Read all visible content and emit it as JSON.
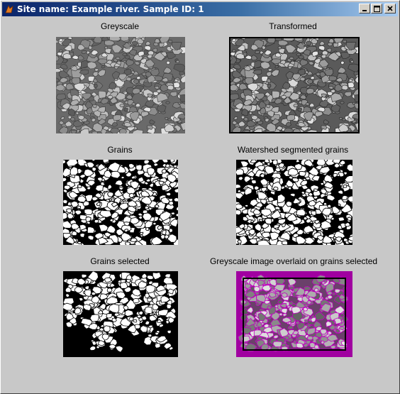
{
  "window": {
    "title": "Site name: Example river. Sample ID: 1",
    "buttons": [
      "minimize",
      "maximize",
      "close"
    ]
  },
  "panels": [
    {
      "title": "Greyscale",
      "image": "greyscale gravel photograph"
    },
    {
      "title": "Transformed",
      "image": "transformed greyscale gravel image"
    },
    {
      "title": "Grains",
      "image": "binary grains image"
    },
    {
      "title": "Watershed segmented grains",
      "image": "watershed segmented binary image"
    },
    {
      "title": "Grains selected",
      "image": "selected grains binary image"
    },
    {
      "title": "Greyscale image overlaid on grains selected",
      "image": "greyscale overlay with magenta grain outlines"
    }
  ],
  "colors": {
    "window_bg": "#c8c8c8",
    "titlebar_start": "#0a246a",
    "titlebar_end": "#a6caf0",
    "overlay": "#b000b0"
  }
}
